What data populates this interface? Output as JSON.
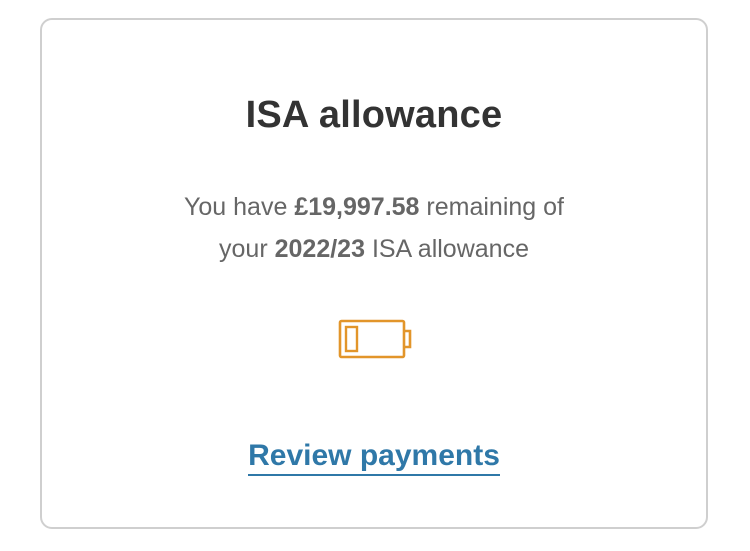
{
  "card": {
    "title": "ISA allowance",
    "description": {
      "prefix": "You have",
      "amount": "£19,997.58",
      "middle": "remaining of",
      "your": "your",
      "tax_year": "2022/23",
      "suffix": "ISA allowance"
    },
    "allowance_icon": {
      "name": "battery-low-icon",
      "color": "#e2952a",
      "fill_level_fraction": 0.0
    },
    "link_label": "Review payments",
    "link_color": "#2f78a8"
  }
}
